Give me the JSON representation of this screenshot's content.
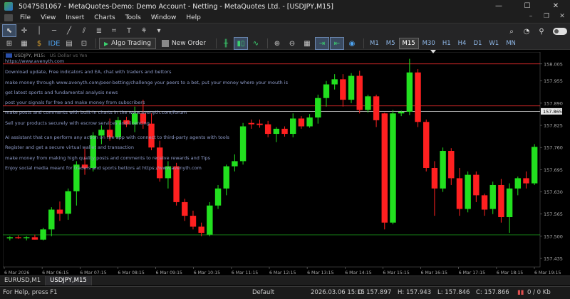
{
  "window": {
    "title": "5047581067 - MetaQuotes-Demo: Demo Account - Netting - MetaQuotes Ltd. - [USDJPY,M15]",
    "minimize": "—",
    "maximize": "☐",
    "close": "✕"
  },
  "menu": {
    "items": [
      "File",
      "View",
      "Insert",
      "Charts",
      "Tools",
      "Window",
      "Help"
    ],
    "win_controls": [
      "–",
      "❐",
      "✕"
    ]
  },
  "toolbar": {
    "algo_trading": "Algo Trading",
    "new_order": "New Order",
    "ide": "IDE",
    "timeframes": [
      "M1",
      "M5",
      "M15",
      "M30",
      "H1",
      "H4",
      "D1",
      "W1",
      "MN"
    ],
    "active_timeframe": "M15"
  },
  "chart": {
    "caption_symbol": "USDJPY, M15:",
    "caption_desc": "US Dollar vs Yen",
    "overlay_lines": [
      "https://www.avenyth.com",
      "Download update, Free indicators and EA, chat with traders and bettors",
      "make money through www.avenyth.com/peer-betting/challenge your peers to a bet, put your money where your mouth is",
      "get latest sports and fundamental analysis news",
      "post your signals for free and make money from subscribers",
      "make posts and comments with built-in charts in the www.avenyth.com/forum",
      "Sell your products securely with escrow services and licencing",
      "AI assistant that can perform any action on the app with connect to third-party agents with tools",
      "Register and get a secure virtual wallet and transaction",
      "make money from making high quality posts and comments to receive rewards and Tips",
      "Enjoy social media meant for traders and sports bettors at https://www.avenyth.com"
    ],
    "current_price_label": "157.865"
  },
  "chart_data": {
    "type": "candlestick",
    "y_ticks": [
      "158.005",
      "157.955",
      "157.890",
      "157.825",
      "157.760",
      "157.695",
      "157.630",
      "157.565",
      "157.500",
      "157.435"
    ],
    "x_ticks": [
      "6 Mar 2026",
      "6 Mar 06:15",
      "6 Mar 07:15",
      "6 Mar 08:15",
      "6 Mar 09:15",
      "6 Mar 10:15",
      "6 Mar 11:15",
      "6 Mar 12:15",
      "6 Mar 13:15",
      "6 Mar 14:15",
      "6 Mar 15:15",
      "6 Mar 16:15",
      "6 Mar 17:15",
      "6 Mar 18:15",
      "6 Mar 19:15"
    ],
    "ylim": [
      157.41,
      158.04
    ],
    "horizontal_levels": [
      158.005,
      157.882,
      157.866,
      157.504
    ],
    "up_color": "#22e01f",
    "down_color": "#ff2020",
    "candles": [
      {
        "o": 157.494,
        "h": 157.5,
        "l": 157.488,
        "c": 157.497
      },
      {
        "o": 157.497,
        "h": 157.503,
        "l": 157.492,
        "c": 157.495
      },
      {
        "o": 157.495,
        "h": 157.5,
        "l": 157.488,
        "c": 157.497
      },
      {
        "o": 157.497,
        "h": 157.505,
        "l": 157.49,
        "c": 157.49
      },
      {
        "o": 157.49,
        "h": 157.525,
        "l": 157.488,
        "c": 157.52
      },
      {
        "o": 157.52,
        "h": 157.585,
        "l": 157.5,
        "c": 157.578
      },
      {
        "o": 157.578,
        "h": 157.602,
        "l": 157.545,
        "c": 157.566
      },
      {
        "o": 157.566,
        "h": 157.64,
        "l": 157.548,
        "c": 157.632
      },
      {
        "o": 157.632,
        "h": 157.72,
        "l": 157.59,
        "c": 157.71
      },
      {
        "o": 157.71,
        "h": 157.76,
        "l": 157.68,
        "c": 157.7
      },
      {
        "o": 157.7,
        "h": 157.805,
        "l": 157.69,
        "c": 157.795
      },
      {
        "o": 157.795,
        "h": 157.825,
        "l": 157.77,
        "c": 157.812
      },
      {
        "o": 157.812,
        "h": 157.845,
        "l": 157.78,
        "c": 157.79
      },
      {
        "o": 157.79,
        "h": 157.85,
        "l": 157.785,
        "c": 157.84
      },
      {
        "o": 157.84,
        "h": 157.85,
        "l": 157.82,
        "c": 157.828
      },
      {
        "o": 157.828,
        "h": 157.88,
        "l": 157.805,
        "c": 157.86
      },
      {
        "o": 157.86,
        "h": 157.9,
        "l": 157.815,
        "c": 157.83
      },
      {
        "o": 157.83,
        "h": 157.86,
        "l": 157.752,
        "c": 157.76
      },
      {
        "o": 157.76,
        "h": 157.78,
        "l": 157.66,
        "c": 157.67
      },
      {
        "o": 157.67,
        "h": 157.72,
        "l": 157.64,
        "c": 157.705
      },
      {
        "o": 157.705,
        "h": 157.715,
        "l": 157.59,
        "c": 157.6
      },
      {
        "o": 157.6,
        "h": 157.61,
        "l": 157.545,
        "c": 157.56
      },
      {
        "o": 157.56,
        "h": 157.575,
        "l": 157.52,
        "c": 157.528
      },
      {
        "o": 157.528,
        "h": 157.54,
        "l": 157.5,
        "c": 157.51
      },
      {
        "o": 157.505,
        "h": 157.6,
        "l": 157.5,
        "c": 157.59
      },
      {
        "o": 157.59,
        "h": 157.65,
        "l": 157.58,
        "c": 157.64
      },
      {
        "o": 157.64,
        "h": 157.71,
        "l": 157.62,
        "c": 157.705
      },
      {
        "o": 157.705,
        "h": 157.74,
        "l": 157.69,
        "c": 157.72
      },
      {
        "o": 157.72,
        "h": 157.832,
        "l": 157.71,
        "c": 157.822
      },
      {
        "o": 157.832,
        "h": 157.842,
        "l": 157.815,
        "c": 157.828
      },
      {
        "o": 157.83,
        "h": 157.842,
        "l": 157.818,
        "c": 157.826
      },
      {
        "o": 157.828,
        "h": 157.838,
        "l": 157.79,
        "c": 157.8
      },
      {
        "o": 157.8,
        "h": 157.82,
        "l": 157.776,
        "c": 157.815
      },
      {
        "o": 157.815,
        "h": 157.822,
        "l": 157.792,
        "c": 157.8
      },
      {
        "o": 157.8,
        "h": 157.86,
        "l": 157.79,
        "c": 157.845
      },
      {
        "o": 157.845,
        "h": 157.852,
        "l": 157.815,
        "c": 157.822
      },
      {
        "o": 157.822,
        "h": 157.858,
        "l": 157.818,
        "c": 157.848
      },
      {
        "o": 157.848,
        "h": 157.915,
        "l": 157.83,
        "c": 157.905
      },
      {
        "o": 157.905,
        "h": 157.955,
        "l": 157.88,
        "c": 157.945
      },
      {
        "o": 157.945,
        "h": 157.975,
        "l": 157.93,
        "c": 157.96
      },
      {
        "o": 157.96,
        "h": 157.975,
        "l": 157.88,
        "c": 157.9
      },
      {
        "o": 157.9,
        "h": 157.978,
        "l": 157.89,
        "c": 157.97
      },
      {
        "o": 157.97,
        "h": 157.985,
        "l": 157.86,
        "c": 157.87
      },
      {
        "o": 157.87,
        "h": 157.915,
        "l": 157.862,
        "c": 157.91
      },
      {
        "o": 157.91,
        "h": 157.915,
        "l": 157.82,
        "c": 157.84
      },
      {
        "o": 157.86,
        "h": 157.862,
        "l": 157.52,
        "c": 157.54
      },
      {
        "o": 157.54,
        "h": 157.87,
        "l": 157.535,
        "c": 157.86
      },
      {
        "o": 157.86,
        "h": 157.868,
        "l": 157.852,
        "c": 157.865
      },
      {
        "o": 157.865,
        "h": 158.02,
        "l": 157.855,
        "c": 157.98
      },
      {
        "o": 157.98,
        "h": 157.99,
        "l": 157.82,
        "c": 157.835
      },
      {
        "o": 157.835,
        "h": 157.842,
        "l": 157.69,
        "c": 157.7
      },
      {
        "o": 157.7,
        "h": 157.72,
        "l": 157.56,
        "c": 157.64
      },
      {
        "o": 157.64,
        "h": 157.76,
        "l": 157.63,
        "c": 157.75
      },
      {
        "o": 157.75,
        "h": 157.758,
        "l": 157.65,
        "c": 157.67
      },
      {
        "o": 157.67,
        "h": 157.7,
        "l": 157.56,
        "c": 157.58
      },
      {
        "o": 157.58,
        "h": 157.69,
        "l": 157.57,
        "c": 157.68
      },
      {
        "o": 157.68,
        "h": 157.69,
        "l": 157.6,
        "c": 157.62
      },
      {
        "o": 157.62,
        "h": 157.625,
        "l": 157.56,
        "c": 157.578
      },
      {
        "o": 157.58,
        "h": 157.66,
        "l": 157.565,
        "c": 157.65
      },
      {
        "o": 157.65,
        "h": 157.668,
        "l": 157.54,
        "c": 157.556
      },
      {
        "o": 157.556,
        "h": 157.655,
        "l": 157.51,
        "c": 157.64
      },
      {
        "o": 157.64,
        "h": 157.675,
        "l": 157.62,
        "c": 157.67
      },
      {
        "o": 157.67,
        "h": 157.69,
        "l": 157.64,
        "c": 157.655
      },
      {
        "o": 157.655,
        "h": 157.77,
        "l": 157.65,
        "c": 157.762
      }
    ]
  },
  "tabs": [
    "EURUSD,M1",
    "USDJPY,M15"
  ],
  "active_tab": 1,
  "status": {
    "help": "For Help, press F1",
    "profile": "Default",
    "time": "2026.03.06 15:15",
    "open": "O: 157.897",
    "high": "H: 157.943",
    "low": "L: 157.846",
    "close": "C: 157.866",
    "traffic": "0 / 0 Kb"
  }
}
